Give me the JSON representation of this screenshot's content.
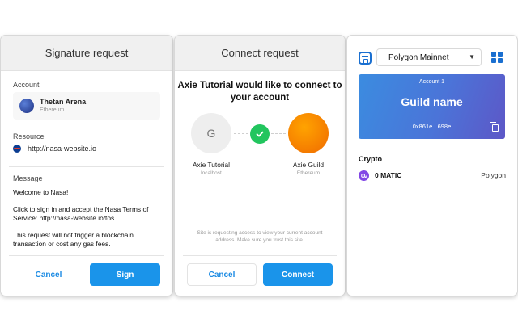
{
  "signature_panel": {
    "title": "Signature request",
    "account_label": "Account",
    "account_name": "Thetan Arena",
    "account_network": "Ethereum",
    "resource_label": "Resource",
    "resource_url": "http://nasa-website.io",
    "message_label": "Message",
    "message_lines": [
      "Welcome to Nasa!",
      "Click to sign in and accept the Nasa Terms of Service: http://nasa-website.io/tos",
      "This request will not trigger a blockchain transaction or cost any gas fees."
    ],
    "cancel_label": "Cancel",
    "sign_label": "Sign"
  },
  "connect_panel": {
    "title": "Connect request",
    "headline": "Axie Tutorial would like to connect to your account",
    "left_node": {
      "initial": "G",
      "name": "Axie Tutorial",
      "sub": "localhost"
    },
    "right_node": {
      "name": "Axie Guild",
      "sub": "Ethereum"
    },
    "notice": "Site is requesting access to view your current account address. Make sure you trust this site.",
    "cancel_label": "Cancel",
    "connect_label": "Connect"
  },
  "wallet_panel": {
    "network": "Polygon Mainnet",
    "account_number": "Account 1",
    "guild_name": "Guild name",
    "address": "0x861e...698e",
    "crypto_label": "Crypto",
    "token_amount": "0 MATIC",
    "token_network": "Polygon"
  },
  "colors": {
    "primary": "#1a94ea",
    "success": "#22c55e",
    "matic": "#8247e5",
    "banner_start": "#3b8ce0",
    "banner_end": "#5d57c7"
  },
  "icons": [
    "nasa-icon",
    "check-icon",
    "wallet-logo-icon",
    "chevron-down-icon",
    "grid-icon",
    "copy-icon",
    "matic-icon"
  ]
}
